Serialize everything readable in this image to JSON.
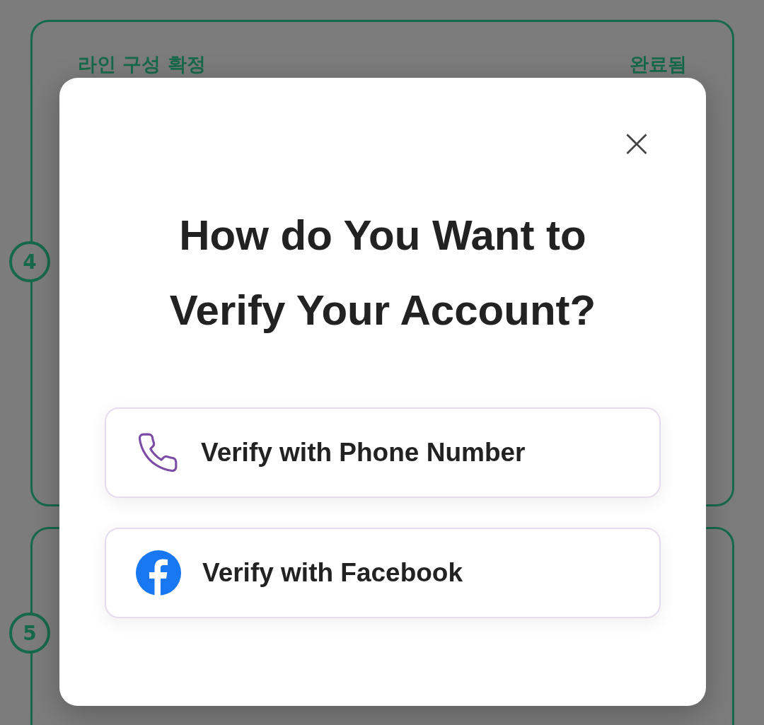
{
  "steps": [
    {
      "number": "4",
      "title": "라인 구성 확정",
      "status": "완료됨"
    },
    {
      "number": "5"
    }
  ],
  "dialog": {
    "close": "×",
    "title": "How do You Want to Verify Your Account?",
    "options": [
      {
        "kind": "phone",
        "label": "Verify with Phone Number"
      },
      {
        "kind": "facebook",
        "label": "Verify with Facebook"
      }
    ]
  }
}
